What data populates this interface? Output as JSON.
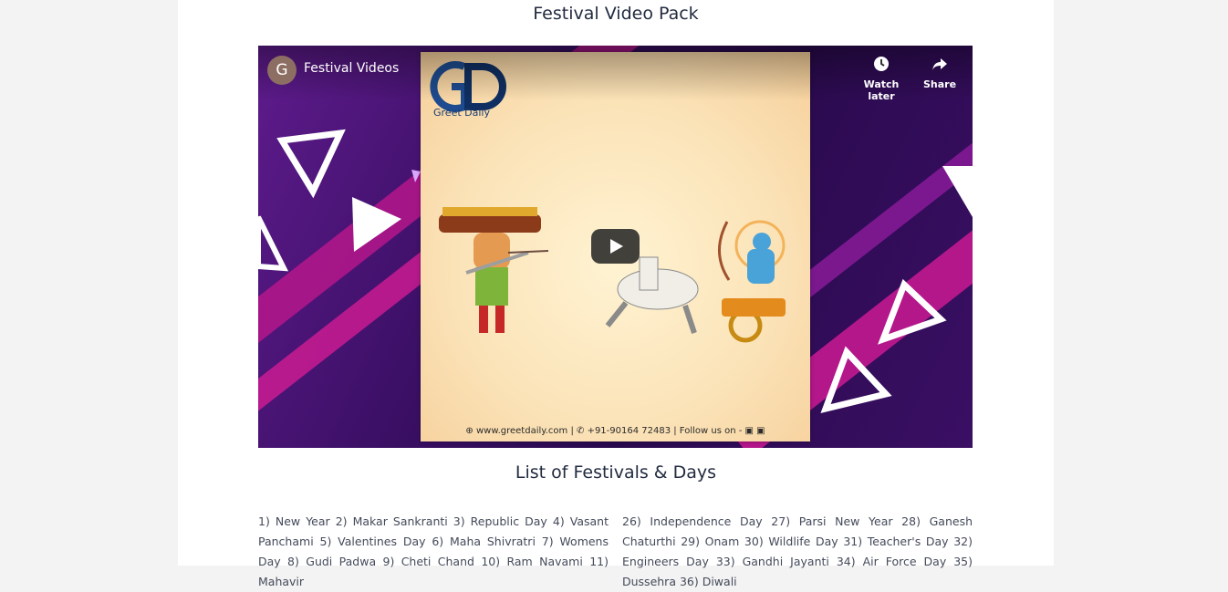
{
  "sections": {
    "video_pack_title": "Festival Video Pack",
    "festival_list_title": "List of Festivals & Days"
  },
  "player": {
    "channel_initial": "G",
    "channel_title": "Festival Videos",
    "watch_later_label": "Watch later",
    "share_label": "Share",
    "brand_name": "Greet Daily",
    "footer_text": "⊕ www.greetdaily.com | ✆ +91-90164 72483 | Follow us on - ▣ ▣"
  },
  "festivals": {
    "left_column": "1) New Year 2) Makar Sankranti 3) Republic Day 4) Vasant Panchami 5) Valentines Day 6) Maha Shivratri 7) Womens Day 8) Gudi Padwa 9) Cheti Chand 10) Ram Navami 11) Mahavir",
    "right_column": "26) Independence Day 27) Parsi New Year 28) Ganesh Chaturthi 29) Onam 30) Wildlife Day 31) Teacher's Day 32) Engineers Day 33) Gandhi Jayanti 34) Air Force Day 35) Dussehra 36) Diwali"
  },
  "colors": {
    "page_background": "#f3f3f3",
    "content_background": "#ffffff",
    "heading_text": "#222b40",
    "video_background": "#3a0f64",
    "accent_magenta": "#c2188f"
  },
  "icons": [
    "clock-icon",
    "share-icon",
    "play-icon"
  ]
}
